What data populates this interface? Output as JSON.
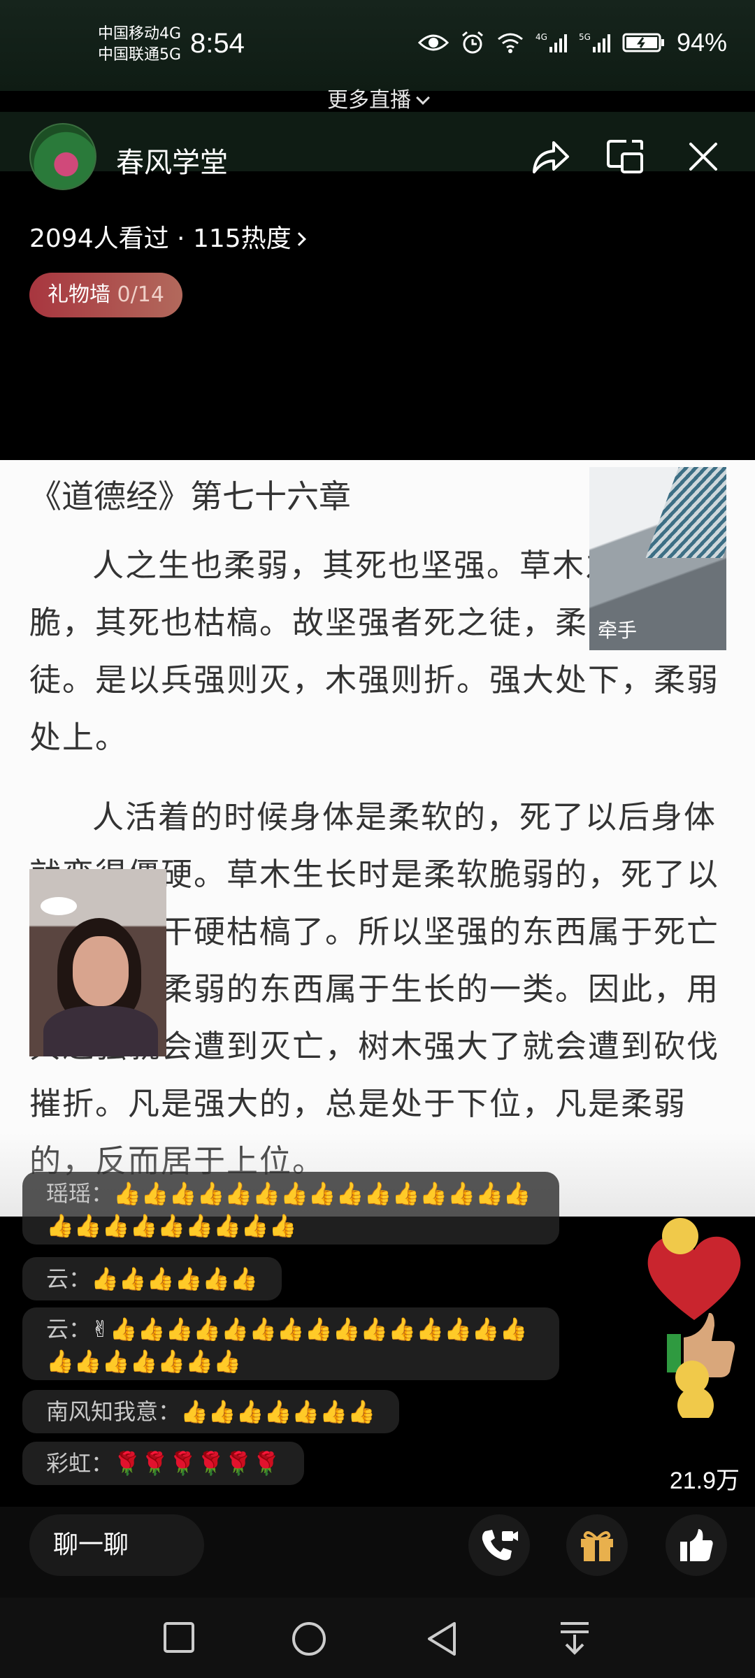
{
  "status_bar": {
    "carrier_1": "中国移动4G",
    "carrier_2": "中国联通5G",
    "time": "8:54",
    "battery": "94%"
  },
  "top": {
    "more_live": "更多直播"
  },
  "header": {
    "room_name": "春风学堂",
    "viewers": "2094人看过 · 115热度",
    "gift_wall_label": "礼物墙",
    "gift_wall_count": "0/14"
  },
  "document": {
    "title": "《道德经》第七十六章",
    "para1": "人之生也柔弱，其死也坚强。草木之生也柔脆，其死也枯槁。故坚强者死之徒，柔弱者生之徒。是以兵强则灭，木强则折。强大处下，柔弱处上。",
    "para2": "人活着的时候身体是柔软的，死了以后身体就变得僵硬。草木生长时是柔软脆弱的，死了以后就变得干硬枯槁了。所以坚强的东西属于死亡的一类，柔弱的东西属于生长的一类。因此，用兵逞强就会遭到灭亡，树木强大了就会遭到砍伐摧折。凡是强大的，总是处于下位，凡是柔弱的，反而居于上位。"
  },
  "co_host": {
    "label": "牵手"
  },
  "comments": [
    {
      "user": "瑶瑶：",
      "text": "👍👍👍👍👍👍👍👍👍👍👍👍👍👍👍👍👍👍👍👍👍👍👍👍"
    },
    {
      "user": "云：",
      "text": "👍👍👍👍👍👍"
    },
    {
      "user": "云：",
      "text": "✌👍👍👍👍👍👍👍👍👍👍👍👍👍👍👍👍👍👍👍👍👍👍"
    },
    {
      "user": "南风知我意：",
      "text": "👍👍👍👍👍👍👍"
    },
    {
      "user": "彩虹：",
      "text": "🌹🌹🌹🌹🌹🌹"
    }
  ],
  "likes": {
    "count": "21.9万"
  },
  "bottom": {
    "chat_placeholder": "聊一聊"
  },
  "colors": {
    "gift_wall": "#a8363f",
    "doc_bg": "#fbfbfb",
    "status_bg": "#16241c"
  }
}
